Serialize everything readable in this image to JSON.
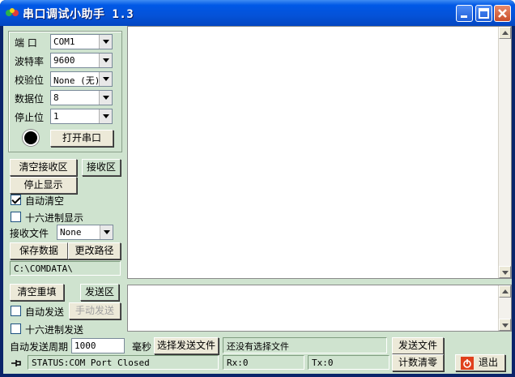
{
  "window": {
    "title": "串口调试小助手  1.3"
  },
  "port_settings": {
    "port_label": "端  口",
    "port_value": "COM1",
    "baud_label": "波特率",
    "baud_value": "9600",
    "parity_label": "校验位",
    "parity_value": "None (无)",
    "databits_label": "数据位",
    "databits_value": "8",
    "stopbits_label": "停止位",
    "stopbits_value": "1",
    "open_button": "打开串口"
  },
  "receive": {
    "clear_button": "清空接收区",
    "area_label": "接收区",
    "stop_display_button": "停止显示",
    "auto_clear_label": "自动清空",
    "auto_clear_checked": true,
    "hex_display_label": "十六进制显示",
    "hex_display_checked": false,
    "file_label": "接收文件",
    "file_value": "None",
    "save_button": "保存数据",
    "change_path_button": "更改路径",
    "path_value": "C:\\COMDATA\\"
  },
  "send": {
    "clear_button": "清空重填",
    "area_label": "发送区",
    "auto_send_label": "自动发送",
    "manual_send_button": "手动发送",
    "hex_send_label": "十六进制发送",
    "period_label": "自动发送周期",
    "period_value": "1000",
    "ms_label": "毫秒",
    "choose_file_button": "选择发送文件",
    "file_status": "还没有选择文件",
    "send_file_button": "发送文件"
  },
  "status_bar": {
    "status_text": "STATUS:COM Port Closed",
    "rx_text": "Rx:0",
    "tx_text": "Tx:0",
    "count_clear_button": "计数清零",
    "exit_button": "退出"
  }
}
